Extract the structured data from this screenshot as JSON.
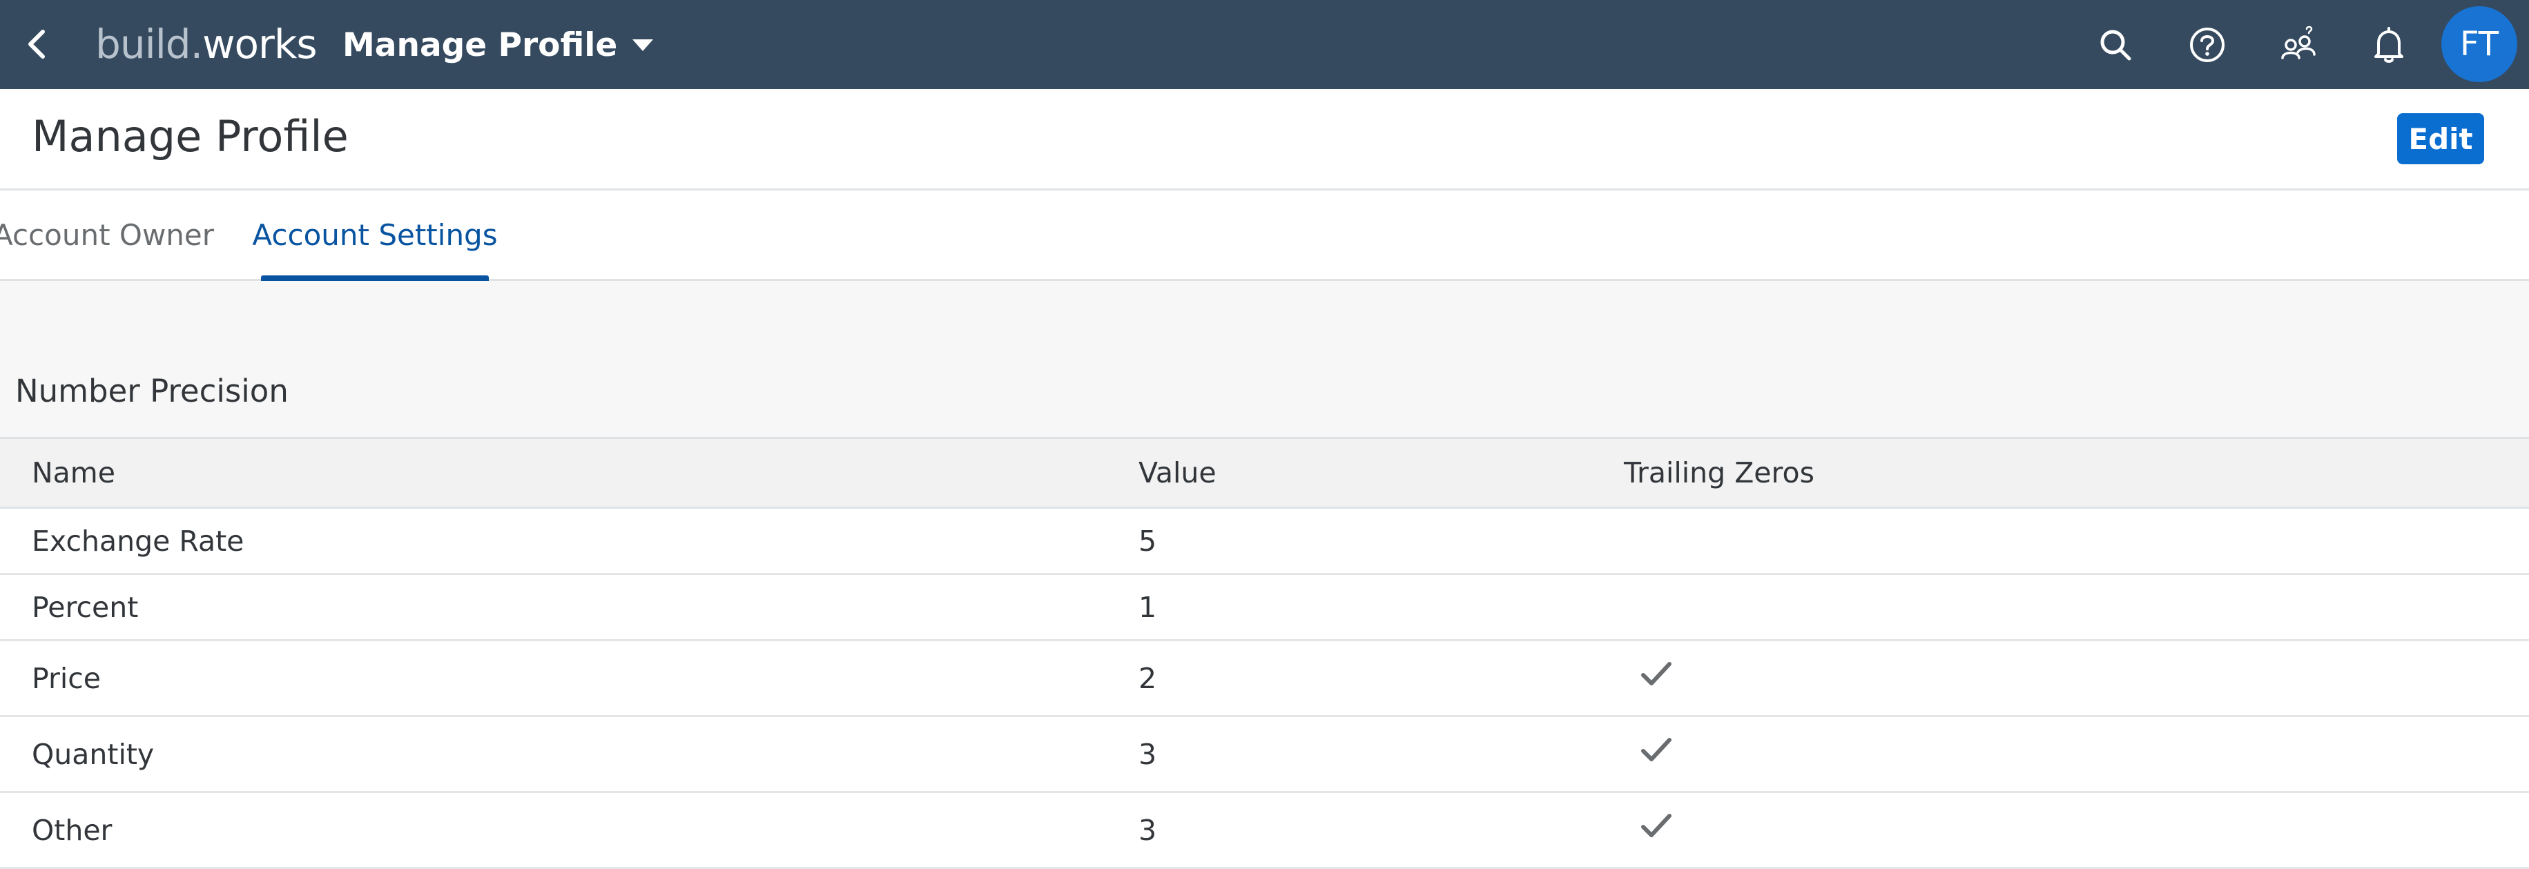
{
  "shell": {
    "logo_part1": "build.",
    "logo_part2": "works",
    "app_title": "Manage Profile",
    "avatar_initials": "FT",
    "background_color": "#354a5f",
    "avatar_color": "#1873d3",
    "icons": [
      "back-arrow-icon",
      "caret-down-icon",
      "search-icon",
      "help-icon",
      "user-group-icon",
      "bell-icon"
    ]
  },
  "header": {
    "title": "Manage Profile",
    "edit_label": "Edit",
    "accent_color": "#0a6ed1"
  },
  "tabs": [
    {
      "label": "Account Owner",
      "selected": false
    },
    {
      "label": "Account Settings",
      "selected": true
    }
  ],
  "section": {
    "title": "Number Precision"
  },
  "table": {
    "columns": [
      "Name",
      "Value",
      "Trailing Zeros"
    ],
    "rows": [
      {
        "name": "Exchange Rate",
        "value": "5",
        "trailing_zeros": false
      },
      {
        "name": "Percent",
        "value": "1",
        "trailing_zeros": false
      },
      {
        "name": "Price",
        "value": "2",
        "trailing_zeros": true
      },
      {
        "name": "Quantity",
        "value": "3",
        "trailing_zeros": true
      },
      {
        "name": "Other",
        "value": "3",
        "trailing_zeros": true
      }
    ]
  }
}
